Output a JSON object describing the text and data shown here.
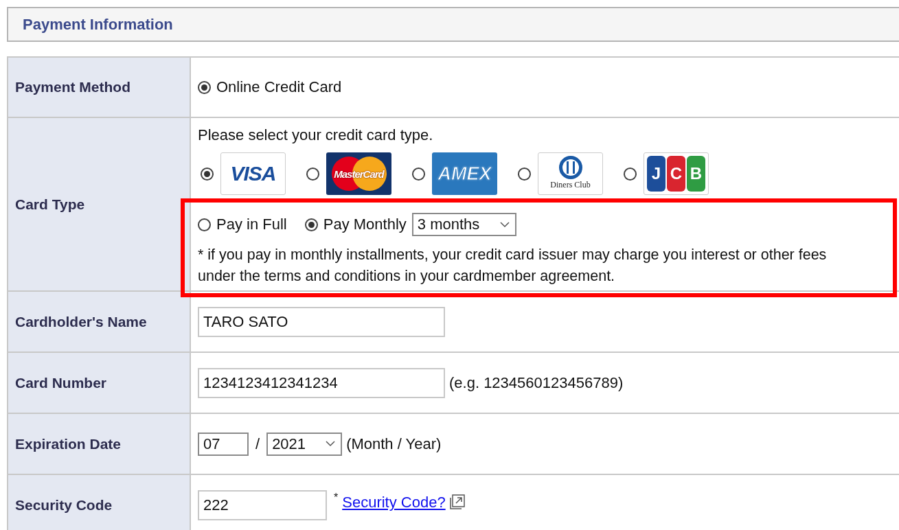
{
  "section_title": "Payment Information",
  "highlight_frame": true,
  "rows": [
    {
      "kind": "method",
      "label": "Payment Method",
      "options": [
        {
          "label": "Online Credit Card",
          "selected": true
        }
      ]
    },
    {
      "kind": "cardtype",
      "label": "Card Type",
      "prompt": "Please select your credit card type.",
      "cards": [
        {
          "kind": "visa",
          "logo_text": "VISA",
          "selected": true
        },
        {
          "kind": "mastercard",
          "logo_text": "MasterCard",
          "selected": false
        },
        {
          "kind": "amex",
          "logo_text": "AMEX",
          "selected": false
        },
        {
          "kind": "diners",
          "logo_text": "Diners Club",
          "selected": false
        },
        {
          "kind": "jcb",
          "logo_text": [
            "J",
            "C",
            "B"
          ],
          "selected": false
        }
      ],
      "payment_options": [
        {
          "label": "Pay in Full",
          "selected": false
        },
        {
          "label": "Pay Monthly",
          "selected": true
        }
      ],
      "months_select": "3 months",
      "note": "* if you pay in monthly installments, your credit card issuer may charge you interest or other fees under the terms and conditions in your cardmember agreement."
    },
    {
      "kind": "text",
      "label": "Cardholder's Name",
      "value": "TARO SATO"
    },
    {
      "kind": "number",
      "label": "Card Number",
      "value": "1234123412341234",
      "hint": "(e.g. 1234560123456789)"
    },
    {
      "kind": "expiry",
      "label": "Expiration Date",
      "month": "07",
      "separator": "/",
      "year": "2021",
      "hint": "(Month / Year)"
    },
    {
      "kind": "security",
      "label": "Security Code",
      "value": "222",
      "mark": "*",
      "link": "Security Code?"
    }
  ]
}
